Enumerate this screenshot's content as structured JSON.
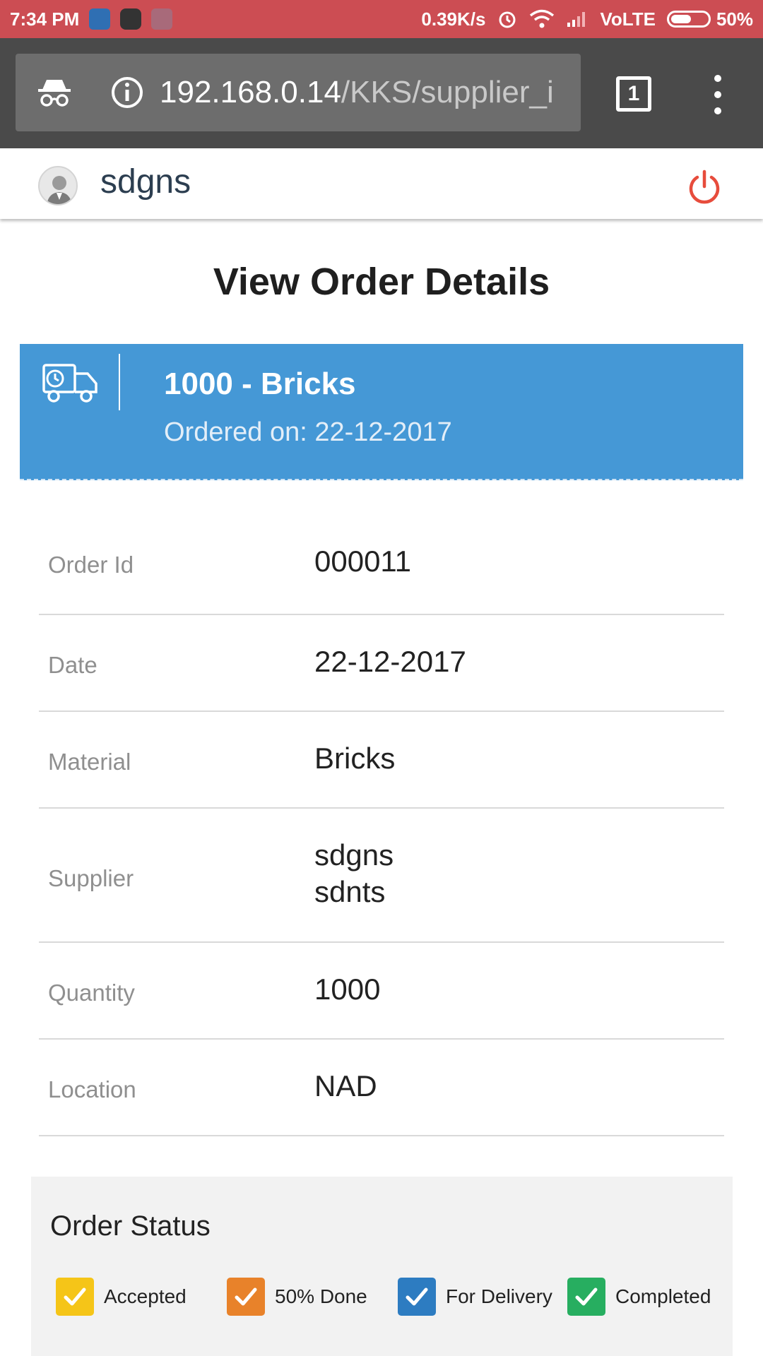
{
  "status_bar": {
    "time": "7:34 PM",
    "net_speed": "0.39K/s",
    "network": "VoLTE",
    "battery": "50%"
  },
  "browser": {
    "url_host": "192.168.0.14",
    "url_path": "/KKS/supplier_i",
    "tab_count": "1"
  },
  "header": {
    "username": "sdgns"
  },
  "page": {
    "title": "View Order Details"
  },
  "order_banner": {
    "title": "1000 - Bricks",
    "subtitle": "Ordered on: 22-12-2017"
  },
  "details": [
    {
      "label": "Order Id",
      "value": "000011"
    },
    {
      "label": "Date",
      "value": "22-12-2017"
    },
    {
      "label": "Material",
      "value": "Bricks"
    },
    {
      "label": "Supplier",
      "value_line1": "sdgns",
      "value_line2": "sdnts"
    },
    {
      "label": "Quantity",
      "value": "1000"
    },
    {
      "label": "Location",
      "value": "NAD"
    }
  ],
  "order_status": {
    "title": "Order Status",
    "legend": [
      {
        "label": "Accepted",
        "color": "#f5c518"
      },
      {
        "label": "50% Done",
        "color": "#e8822a"
      },
      {
        "label": "For Delivery",
        "color": "#2d7cc1"
      },
      {
        "label": "Completed",
        "color": "#27ae60"
      }
    ]
  },
  "colors": {
    "status_bar": "#cc4d53",
    "banner": "#4598d6",
    "power_icon": "#e74c3c"
  }
}
